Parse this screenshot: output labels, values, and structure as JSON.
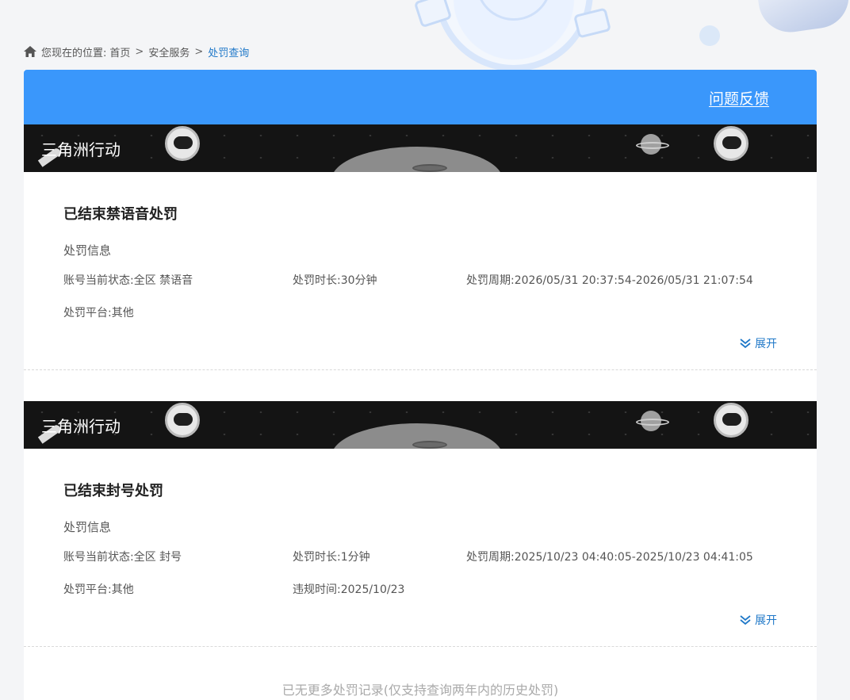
{
  "page": {
    "title_stub": "",
    "accent": "#3a97fb",
    "link_color": "#1f78c8"
  },
  "breadcrumb": {
    "prefix": "您现在的位置:",
    "items": [
      "首页",
      "安全服务",
      "处罚查询"
    ],
    "separator": ">"
  },
  "header": {
    "feedback_label": "问题反馈"
  },
  "records": [
    {
      "game": "三角洲行动",
      "title": "已结束禁语音处罚",
      "subtitle": "处罚信息",
      "status": "账号当前状态:全区 禁语音",
      "duration": "处罚时长:30分钟",
      "period": "处罚周期:2026/05/31 20:37:54-2026/05/31 21:07:54",
      "platform": "处罚平台:其他",
      "violation_time": "",
      "expand_label": "展开"
    },
    {
      "game": "三角洲行动",
      "title": "已结束封号处罚",
      "subtitle": "处罚信息",
      "status": "账号当前状态:全区 封号",
      "duration": "处罚时长:1分钟",
      "period": "处罚周期:2025/10/23 04:40:05-2025/10/23 04:41:05",
      "platform": "处罚平台:其他",
      "violation_time": "违规时间:2025/10/23",
      "expand_label": "展开"
    }
  ],
  "footer_note": "已无更多处罚记录(仅支持查询两年内的历史处罚)"
}
